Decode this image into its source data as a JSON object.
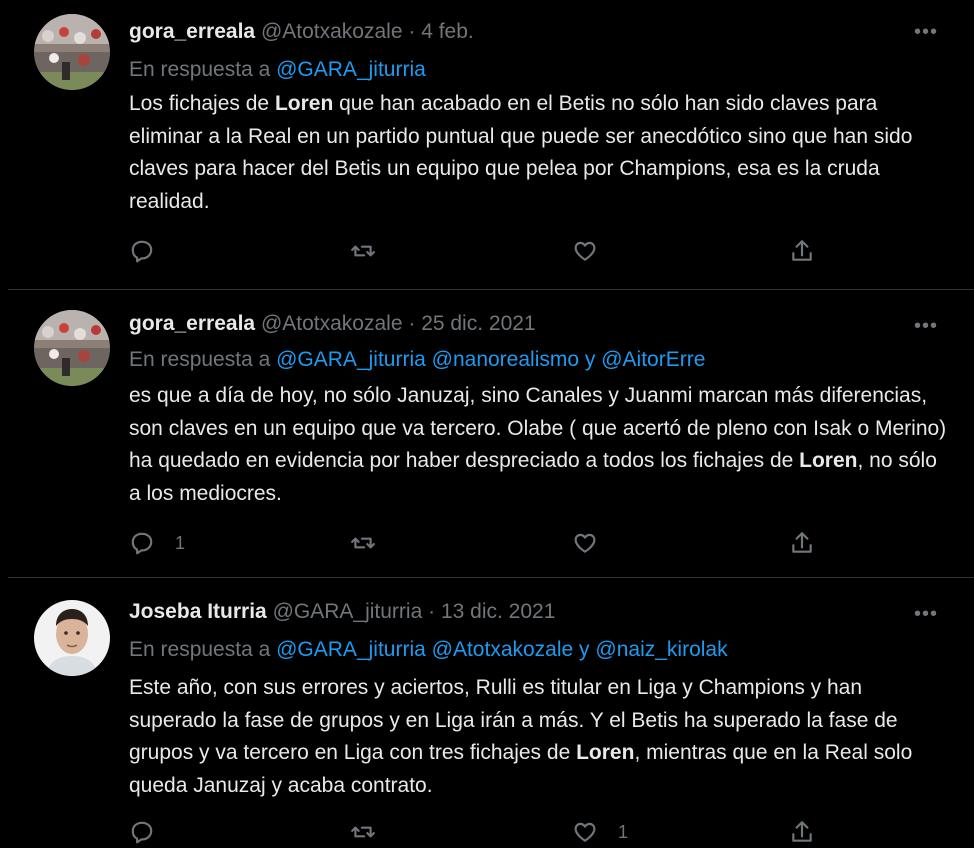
{
  "colors": {
    "background": "#000000",
    "text": "#e7e9ea",
    "muted": "#71767b",
    "link": "#1d9bf0",
    "separator": "#2f3336"
  },
  "tweets": [
    {
      "name": "gora_erreala",
      "handle": "@Atotxakozale",
      "dot": "·",
      "date": "4 feb.",
      "reply_label": "En respuesta a",
      "mentions": [
        "@GARA_jiturria"
      ],
      "body_lines": [
        "Los fichajes de ",
        "Loren",
        " que han acabado en el Betis no sólo han sido claves para eliminar a la Real en un partido puntual que puede ser anecdótico sino que han sido claves para hacer del Betis un equipo que pelea por Champions, esa es la cruda realidad."
      ],
      "reply_count": "",
      "retweet_count": "",
      "like_count": ""
    },
    {
      "name": "gora_erreala",
      "handle": "@Atotxakozale",
      "dot": "·",
      "date": "25 dic. 2021",
      "reply_label": "En respuesta a",
      "mentions": [
        "@GARA_jiturria",
        "@nanorealismo",
        "y",
        "@AitorErre"
      ],
      "body_lines": [
        "es que a día de hoy, no sólo Januzaj, sino Canales y Juanmi marcan más diferencias, son claves en un equipo que va tercero. Olabe ( que acertó de pleno con Isak o Merino) ha quedado en evidencia por haber despreciado a todos los fichajes de ",
        "Loren",
        ", no sólo a los mediocres."
      ],
      "reply_count": "1",
      "retweet_count": "",
      "like_count": ""
    },
    {
      "name": "Joseba Iturria",
      "handle": "@GARA_jiturria",
      "dot": "·",
      "date": "13 dic. 2021",
      "reply_label": "En respuesta a",
      "mentions": [
        "@GARA_jiturria",
        "@Atotxakozale",
        "y",
        "@naiz_kirolak"
      ],
      "body_lines": [
        "Este año, con sus errores y aciertos, Rulli es titular en Liga y Champions y han superado la fase de grupos y en Liga irán a más. Y el Betis ha superado la fase de grupos y va tercero en Liga con tres fichajes de ",
        "Loren",
        ", mientras que en la Real solo queda Januzaj y acaba contrato."
      ],
      "reply_count": "",
      "retweet_count": "",
      "like_count": "1"
    }
  ],
  "icons": {
    "more": "more-icon",
    "reply": "reply-icon",
    "retweet": "retweet-icon",
    "like": "like-icon",
    "share": "share-icon"
  }
}
